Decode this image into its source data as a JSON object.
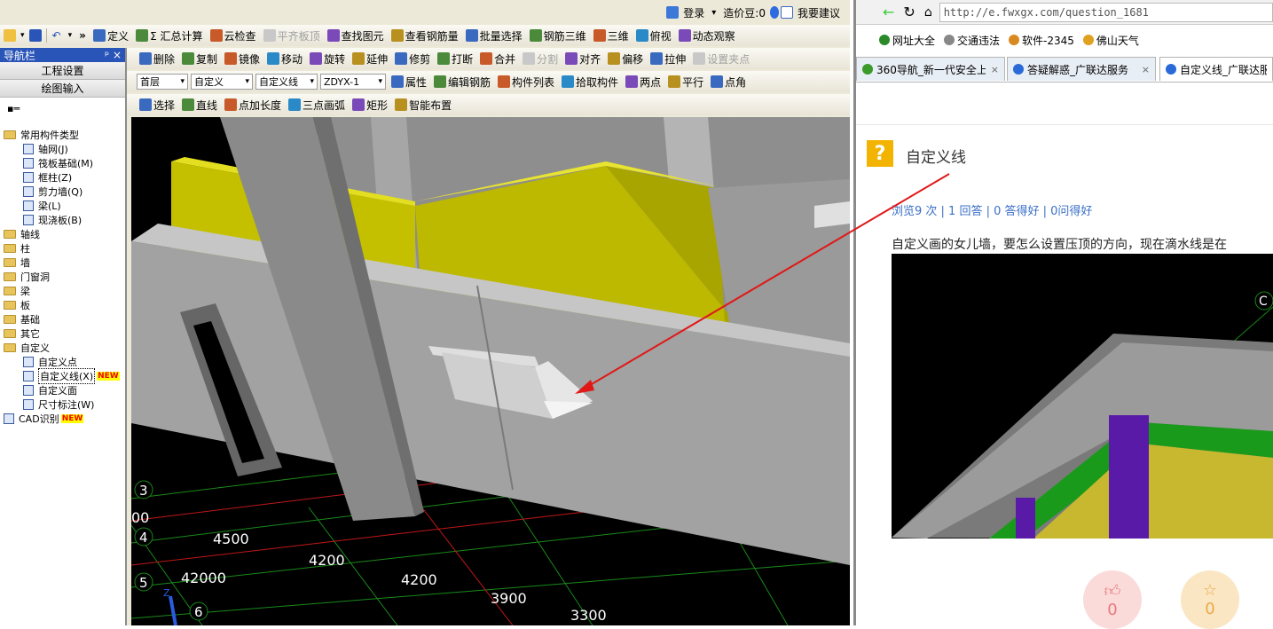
{
  "app": {
    "login": "登录",
    "beans": "造价豆:0",
    "suggest": "我要建议",
    "row1": [
      {
        "n": "define",
        "t": "定义"
      },
      {
        "n": "summary-calc",
        "t": "Σ 汇总计算"
      },
      {
        "n": "cloud-check",
        "t": "云检查"
      },
      {
        "n": "flush-slab",
        "t": "平齐板顶",
        "dis": true
      },
      {
        "n": "find-element",
        "t": "查找图元"
      },
      {
        "n": "view-rebar",
        "t": "查看钢筋量"
      },
      {
        "n": "batch-select",
        "t": "批量选择"
      },
      {
        "n": "rebar-3d",
        "t": "钢筋三维"
      },
      {
        "n": "3d",
        "t": "三维"
      },
      {
        "n": "top-view",
        "t": "俯视"
      },
      {
        "n": "dynamic-observe",
        "t": "动态观察"
      }
    ],
    "row2": [
      {
        "n": "delete",
        "t": "删除"
      },
      {
        "n": "copy",
        "t": "复制"
      },
      {
        "n": "mirror",
        "t": "镜像"
      },
      {
        "n": "move",
        "t": "移动"
      },
      {
        "n": "rotate",
        "t": "旋转"
      },
      {
        "n": "extend",
        "t": "延伸"
      },
      {
        "n": "trim",
        "t": "修剪"
      },
      {
        "n": "break",
        "t": "打断"
      },
      {
        "n": "merge",
        "t": "合并"
      },
      {
        "n": "split",
        "t": "分割",
        "dis": true
      },
      {
        "n": "align",
        "t": "对齐"
      },
      {
        "n": "offset",
        "t": "偏移"
      },
      {
        "n": "stretch",
        "t": "拉伸"
      },
      {
        "n": "set-grip",
        "t": "设置夹点",
        "dis": true
      }
    ],
    "row3": {
      "floor": "首层",
      "type": "自定义",
      "sub": "自定义线",
      "code": "ZDYX-1",
      "btns": [
        {
          "n": "properties",
          "t": "属性"
        },
        {
          "n": "edit-rebar",
          "t": "编辑钢筋"
        },
        {
          "n": "component-list",
          "t": "构件列表"
        },
        {
          "n": "pick-component",
          "t": "拾取构件"
        },
        {
          "n": "two-points",
          "t": "两点"
        },
        {
          "n": "parallel",
          "t": "平行"
        },
        {
          "n": "point-angle",
          "t": "点角"
        }
      ]
    },
    "row4": [
      {
        "n": "select",
        "t": "选择"
      },
      {
        "n": "line",
        "t": "直线"
      },
      {
        "n": "point-length",
        "t": "点加长度"
      },
      {
        "n": "three-point-arc",
        "t": "三点画弧"
      },
      {
        "n": "rectangle",
        "t": "矩形"
      },
      {
        "n": "smart-place",
        "t": "智能布置"
      }
    ]
  },
  "nav": {
    "title": "导航栏",
    "project_settings": "工程设置",
    "drawing_input": "绘图输入",
    "tree": [
      {
        "t": "常用构件类型",
        "lv": 0,
        "f": 1
      },
      {
        "t": "轴网(J)",
        "lv": 1
      },
      {
        "t": "筏板基础(M)",
        "lv": 1
      },
      {
        "t": "框柱(Z)",
        "lv": 1
      },
      {
        "t": "剪力墙(Q)",
        "lv": 1
      },
      {
        "t": "梁(L)",
        "lv": 1
      },
      {
        "t": "现浇板(B)",
        "lv": 1
      },
      {
        "t": "轴线",
        "lv": 0,
        "f": 1
      },
      {
        "t": "柱",
        "lv": 0,
        "f": 1
      },
      {
        "t": "墙",
        "lv": 0,
        "f": 1
      },
      {
        "t": "门窗洞",
        "lv": 0,
        "f": 1
      },
      {
        "t": "梁",
        "lv": 0,
        "f": 1
      },
      {
        "t": "板",
        "lv": 0,
        "f": 1
      },
      {
        "t": "基础",
        "lv": 0,
        "f": 1
      },
      {
        "t": "其它",
        "lv": 0,
        "f": 1
      },
      {
        "t": "自定义",
        "lv": 0,
        "f": 1
      },
      {
        "t": "自定义点",
        "lv": 1
      },
      {
        "t": "自定义线(X)",
        "lv": 1,
        "sel": 1,
        "nw": 1
      },
      {
        "t": "自定义面",
        "lv": 1
      },
      {
        "t": "尺寸标注(W)",
        "lv": 1
      },
      {
        "t": "CAD识别",
        "lv": 0,
        "nw": 1
      }
    ]
  },
  "new_badge": "NEW",
  "viewport": {
    "axis_labels": [
      "3",
      "4",
      "5",
      "6"
    ],
    "dim_labels": [
      "00",
      "4500",
      "4200",
      "42000",
      "4200",
      "3900",
      "3300"
    ],
    "axis_z": "Z"
  },
  "browser": {
    "url": "http://e.fwxgx.com/question_1681",
    "bookmarks": [
      "网址大全",
      "交通违法",
      "软件-2345",
      "佛山天气"
    ],
    "tabs": [
      "360导航_新一代安全上",
      "答疑解惑_广联达服务",
      "自定义线_广联达服务"
    ],
    "question_title": "自定义线",
    "stats": "浏览9 次 | 1 回答 | 0 答得好 | 0问得好",
    "question_text": "自定义画的女儿墙，要怎么设置压顶的方向，现在滴水线是在",
    "image_label": "C",
    "like_count": "0",
    "fav_count": "0"
  }
}
